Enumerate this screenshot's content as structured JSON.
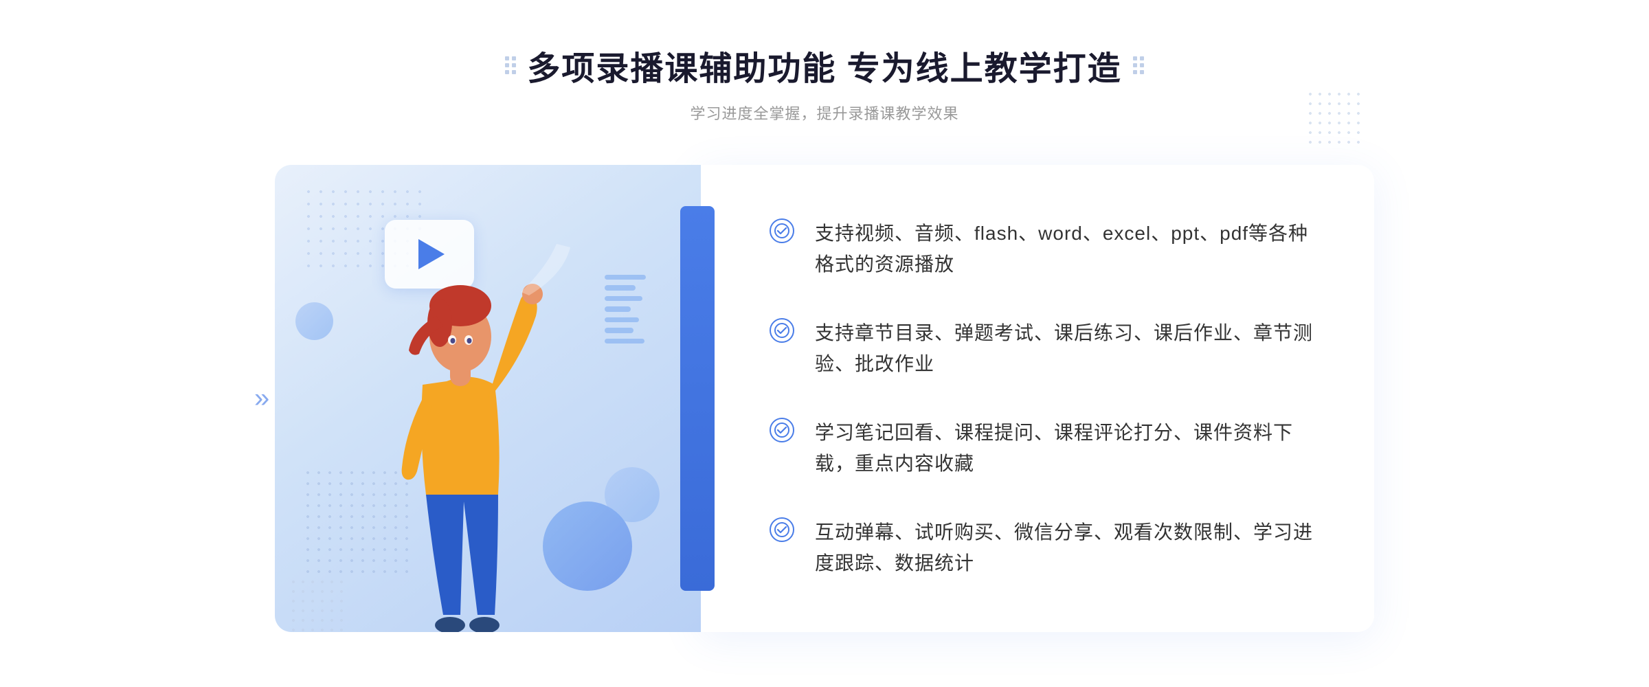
{
  "header": {
    "title": "多项录播课辅助功能 专为线上教学打造",
    "subtitle": "学习进度全掌握，提升录播课教学效果"
  },
  "features": [
    {
      "id": 1,
      "text": "支持视频、音频、flash、word、excel、ppt、pdf等各种格式的资源播放"
    },
    {
      "id": 2,
      "text": "支持章节目录、弹题考试、课后练习、课后作业、章节测验、批改作业"
    },
    {
      "id": 3,
      "text": "学习笔记回看、课程提问、课程评论打分、课件资料下载，重点内容收藏"
    },
    {
      "id": 4,
      "text": "互动弹幕、试听购买、微信分享、观看次数限制、学习进度跟踪、数据统计"
    }
  ],
  "icons": {
    "check": "✓",
    "play": "▶",
    "chevrons": "»",
    "dots_decoration": "⁞⁞"
  },
  "colors": {
    "primary": "#4a7de8",
    "title": "#1a1a2e",
    "subtitle": "#999999",
    "text": "#333333",
    "bg_illustration": "#dce9f8",
    "accent_bar": "#4a7de8"
  }
}
